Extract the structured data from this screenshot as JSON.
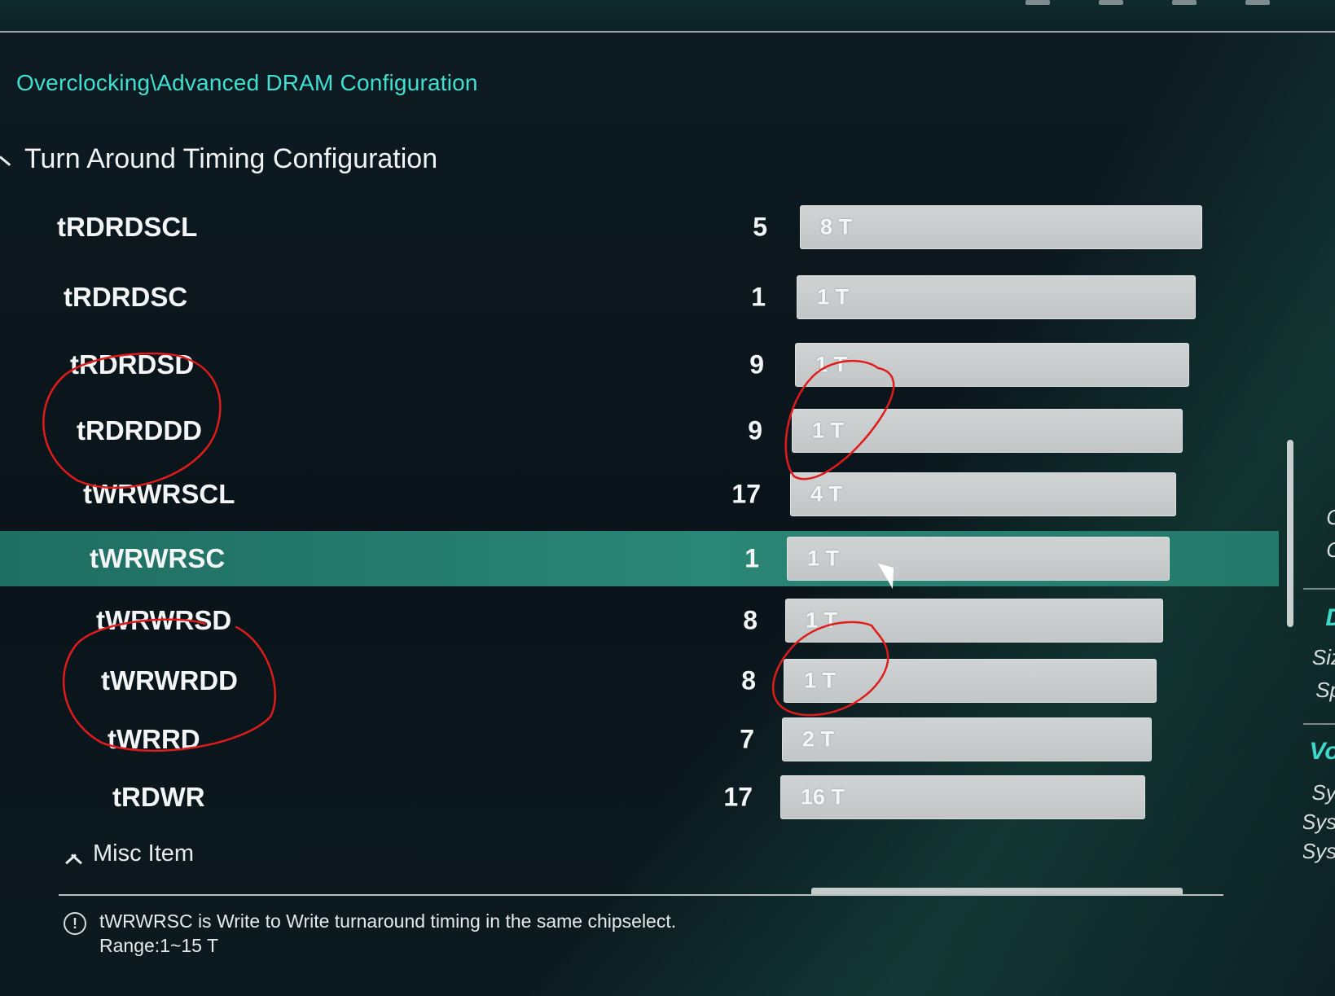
{
  "breadcrumb": "Overclocking\\Advanced DRAM Configuration",
  "section_title": "Turn Around Timing Configuration",
  "rows": [
    {
      "name": "tRDRDSCL",
      "value": "5",
      "setting": "8 T"
    },
    {
      "name": "tRDRDSC",
      "value": "1",
      "setting": "1 T"
    },
    {
      "name": "tRDRDSD",
      "value": "9",
      "setting": "1 T"
    },
    {
      "name": "tRDRDDD",
      "value": "9",
      "setting": "1 T"
    },
    {
      "name": "tWRWRSCL",
      "value": "17",
      "setting": "4 T"
    },
    {
      "name": "tWRWRSC",
      "value": "1",
      "setting": "1 T",
      "selected": true
    },
    {
      "name": "tWRWRSD",
      "value": "8",
      "setting": "1 T"
    },
    {
      "name": "tWRWRDD",
      "value": "8",
      "setting": "1 T"
    },
    {
      "name": "tWRRD",
      "value": "7",
      "setting": "2 T"
    },
    {
      "name": "tRDWR",
      "value": "17",
      "setting": "16 T"
    }
  ],
  "misc_item": "Misc Item",
  "help": {
    "line1": "tWRWRSC is Write to Write turnaround timing in the same chipselect.",
    "line2": "Range:1~15 T"
  },
  "right_panel": {
    "c1": "C",
    "c2": "C",
    "dram_heading": "D",
    "size_label": "Siz",
    "speed_label": "Sp",
    "voltage_heading": "Vol",
    "sys1": "Syst",
    "sys2": "Syste",
    "sys3": "Syste"
  },
  "colors": {
    "accent": "#3fe0d0",
    "selected_row": "#2a8676",
    "annotation": "#e01b1b"
  }
}
